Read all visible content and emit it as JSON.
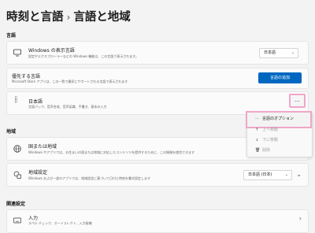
{
  "breadcrumb": {
    "parent": "時刻と言語",
    "separator": "›",
    "current": "言語と地域"
  },
  "language_section": {
    "heading": "言語",
    "display_language": {
      "title": "Windows の表示言語",
      "subtitle": "設定やエクスプローラーなどの Windows 機能は、この言語で表示されます。",
      "value": "日本語"
    },
    "preferred_languages": {
      "title": "優先する言語",
      "subtitle": "Microsoft Store アプリは、この一覧で最初にサポートされる言語で表示されます",
      "add_button": "言語の追加"
    },
    "japanese_item": {
      "title": "日本語",
      "subtitle": "言語パック、音声合成、音声認識、手書き、基本の入力",
      "more_label": "..."
    },
    "context_menu": {
      "items": [
        {
          "label": "言語のオプション",
          "icon": "ellipsis-icon",
          "enabled": true
        },
        {
          "label": "上へ移動",
          "icon": "arrow-up-icon",
          "enabled": false
        },
        {
          "label": "下に移動",
          "icon": "arrow-down-icon",
          "enabled": false
        },
        {
          "label": "削除",
          "icon": "trash-icon",
          "enabled": false
        }
      ]
    }
  },
  "region_section": {
    "heading": "地域",
    "country": {
      "title": "国または地域",
      "subtitle": "Windows やアプリでは、お住まいの国または地域に対応したコンテンツを提供するために、この情報を使用できます"
    },
    "regional_format": {
      "title": "地域設定",
      "subtitle": "Windows およびー部のアプリでは、地域設定に基づいて日付と時刻を書式設定します",
      "value": "日本語 (日本)"
    }
  },
  "related_section": {
    "heading": "関連設定",
    "input": {
      "title": "入力",
      "subtitle": "スペル チェック、オートコレクト、入力候補"
    }
  },
  "colors": {
    "accent": "#0067c0",
    "highlight": "#f0a6c9",
    "background": "#f3f3f3"
  }
}
